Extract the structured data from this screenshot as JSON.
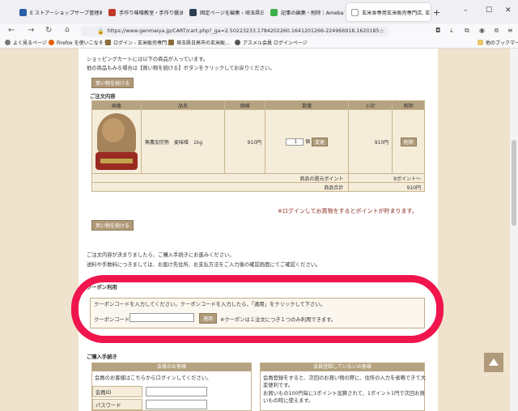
{
  "browser": {
    "tabs": [
      {
        "label": "E ストアーショップサーブ管理画",
        "color": "#2b5ea7"
      },
      {
        "label": "手作り味噌教室・手作り醤油教室",
        "color": "#c0392b"
      },
      {
        "label": "固定ページを編集 ‹ 埼玉県日高市",
        "color": "#2c3e50"
      },
      {
        "label": "記事の編集・削除｜Amebaブロ",
        "color": "#3cb04a"
      },
      {
        "label": "玄米食専用玄米販売専門店, 玄",
        "color": "#ffffff"
      }
    ],
    "new_tab": "+",
    "window_controls": [
      "–",
      "☐",
      "✕"
    ],
    "url": "https://www.genmaiya.jp/CART/cart.php?_ga=2.50223233.1784202260.1641201266-224966918.16201852",
    "bookmarks": [
      {
        "label": "よく見るページ",
        "icon": "gear-icon",
        "color": "#777777"
      },
      {
        "label": "Firefox を使いこなそう",
        "icon": "firefox-icon",
        "color": "#e66000"
      },
      {
        "label": "ログイン - 玄米販売専門...",
        "icon": "shop-icon",
        "color": "#8a6d3b"
      },
      {
        "label": "埼玉県日高市の玄米販...",
        "icon": "shop-icon",
        "color": "#8a6d3b"
      },
      {
        "label": "アスメル会員 ログインページ",
        "icon": "orb-icon",
        "color": "#555555"
      }
    ],
    "other_bookmarks": "他のブックマーク"
  },
  "page": {
    "intro1": "ショッピングカートには以下の商品が入っています。",
    "intro2": "他の商品もみる場合は【買い物を続ける】ボタンをクリックしてお戻りください。",
    "continue_btn": "買い物を続ける",
    "order_heading": "ご注文内容",
    "cart_headers": [
      "画像",
      "品名",
      "価格",
      "数量",
      "小計",
      "削除"
    ],
    "cart_item": {
      "name": "無農加完熟　麦味噌　1kg",
      "price": "910円",
      "qty": "1",
      "unit": "個",
      "change_btn": "変更",
      "subtotal": "910円",
      "delete_btn": "削除"
    },
    "points_label": "商品の還元ポイント",
    "points_value": "9ポイント～",
    "total_label": "商品合計",
    "total_value": "910円",
    "login_note": "※ログインしてお買物をするとポイントが貯まります。",
    "continue_btn2": "買い物を続ける",
    "order_note1": "ご注文内容が決まりましたら、ご購入手続きにお進みください。",
    "order_note2": "送料や手数料につきましては、お届け先住所、お支払方法をご入力後の確認画面にてご確認ください。",
    "coupon_heading": "クーポン利用",
    "coupon_instr": "クーポンコードを入力してください。クーポンコードを入力したら、「適用」をクリックして下さい。",
    "coupon_label": "クーポンコード",
    "coupon_apply": "適用",
    "coupon_note": "※クーポンは１注文につき１つのみ利用できます。",
    "purchase_heading": "ご購入手続き",
    "member_header": "会員のお客様",
    "member_text": "会員のお客様はこちらからログインしてください。",
    "member_id_label": "会員ID",
    "password_label": "パスワード",
    "nonmember_header": "会員登録していないお客様",
    "nonmember_text1": "会員登録をすると、次回のお買い物の際に、住所の入力を省略できて大",
    "nonmember_text2": "変便利です。",
    "nonmember_text3": "お買いもの100円毎に1ポイント加算されて、1ポイント1円で次回お買",
    "nonmember_text4": "いもの時に使えます。"
  },
  "colors": {
    "accent": "#b09a7a",
    "page_bg": "#efe3cd",
    "highlight": "#f0154d"
  }
}
